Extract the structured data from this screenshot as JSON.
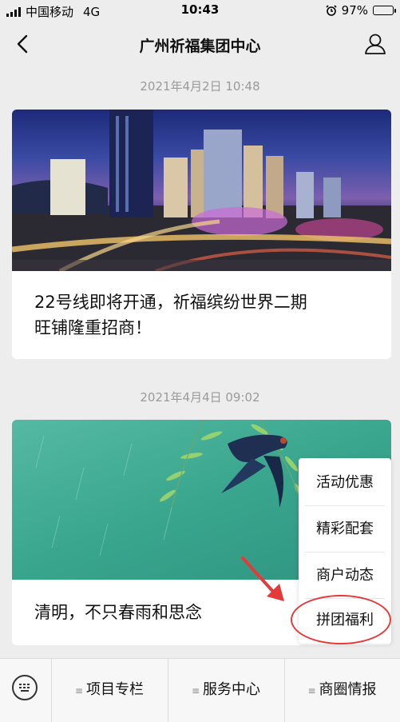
{
  "status_bar": {
    "carrier": "中国移动",
    "network": "4G",
    "time": "10:43",
    "battery": "97%",
    "battery_level": 0.97
  },
  "nav": {
    "title": "广州祈福集团中心"
  },
  "feed": [
    {
      "timestamp": "2021年4月2日 10:48",
      "title_line1": "22号线即将开通，祈福缤纷世界二期",
      "title_line2": "旺铺隆重招商！",
      "image": "city-night-image"
    },
    {
      "timestamp": "2021年4月4日 09:02",
      "title_line1": "清明，不只春雨和思念",
      "image": "swallow-willow-image"
    }
  ],
  "popup_menu": {
    "items": [
      "活动优惠",
      "精彩配套",
      "商户动态",
      "拼团福利"
    ],
    "highlighted": "拼团福利",
    "highlight_color": "#e43a3a"
  },
  "bottom_menu": {
    "items": [
      "项目专栏",
      "服务中心",
      "商圈情报"
    ]
  }
}
